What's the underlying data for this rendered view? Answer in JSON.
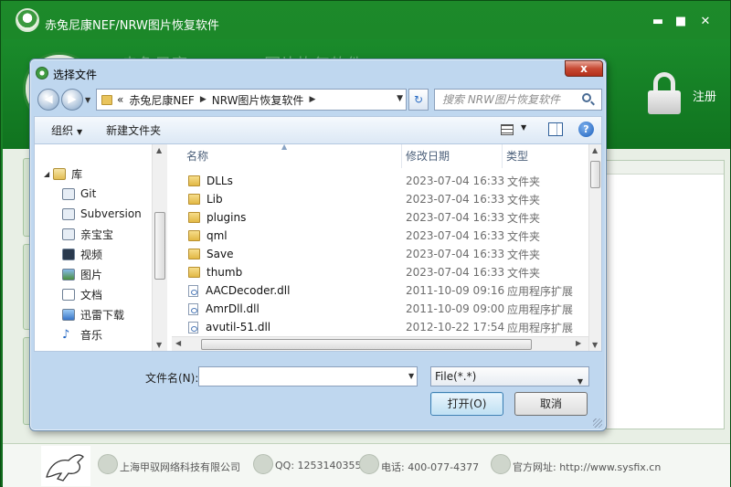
{
  "app": {
    "title": "赤兔尼康NEF/NRW图片恢复软件",
    "header_ghost_title": "赤兔尼康NEF/NRW图片恢复软件",
    "register_label": "注册",
    "win_min": "▬",
    "win_max": "■",
    "win_close": "✕"
  },
  "footer": {
    "company": "上海甲驭网络科技有限公司",
    "qq": "QQ: 1253140355",
    "phone": "电话: 400-077-4377",
    "website": "官方网址: http://www.sysfix.cn"
  },
  "dialog": {
    "title": "选择文件",
    "close": "x",
    "back_symbol": "◀",
    "forward_symbol": "▶",
    "breadcrumb_prefix": "«",
    "breadcrumb": [
      "赤兔尼康NEF",
      "NRW图片恢复软件"
    ],
    "refresh_symbol": "↻",
    "search_placeholder": "搜索 NRW图片恢复软件",
    "toolbar": {
      "organize": "组织",
      "new_folder": "新建文件夹",
      "help": "?"
    },
    "tree": {
      "root": "库",
      "items": [
        {
          "label": "Git",
          "icon": "git-icon"
        },
        {
          "label": "Subversion",
          "icon": "subversion-icon"
        },
        {
          "label": "亲宝宝",
          "icon": "app-icon"
        },
        {
          "label": "视频",
          "icon": "video-icon"
        },
        {
          "label": "图片",
          "icon": "picture-icon"
        },
        {
          "label": "文档",
          "icon": "document-icon"
        },
        {
          "label": "迅雷下载",
          "icon": "thunder-download-icon"
        },
        {
          "label": "音乐",
          "icon": "music-icon"
        }
      ]
    },
    "columns": {
      "name": "名称",
      "date": "修改日期",
      "type": "类型"
    },
    "files": [
      {
        "name": "DLLs",
        "date": "2023-07-04 16:33",
        "type": "文件夹",
        "kind": "folder"
      },
      {
        "name": "Lib",
        "date": "2023-07-04 16:33",
        "type": "文件夹",
        "kind": "folder"
      },
      {
        "name": "plugins",
        "date": "2023-07-04 16:33",
        "type": "文件夹",
        "kind": "folder"
      },
      {
        "name": "qml",
        "date": "2023-07-04 16:33",
        "type": "文件夹",
        "kind": "folder"
      },
      {
        "name": "Save",
        "date": "2023-07-04 16:33",
        "type": "文件夹",
        "kind": "folder"
      },
      {
        "name": "thumb",
        "date": "2023-07-04 16:33",
        "type": "文件夹",
        "kind": "folder"
      },
      {
        "name": "AACDecoder.dll",
        "date": "2011-10-09 09:16",
        "type": "应用程序扩展",
        "kind": "dll"
      },
      {
        "name": "AmrDll.dll",
        "date": "2011-10-09 09:00",
        "type": "应用程序扩展",
        "kind": "dll"
      },
      {
        "name": "avutil-51.dll",
        "date": "2012-10-22 17:54",
        "type": "应用程序扩展",
        "kind": "dll"
      }
    ],
    "filename_label": "文件名(N):",
    "filename_value": "",
    "filter_value": "File(*.*)",
    "open_button": "打开(O)",
    "cancel_button": "取消"
  }
}
